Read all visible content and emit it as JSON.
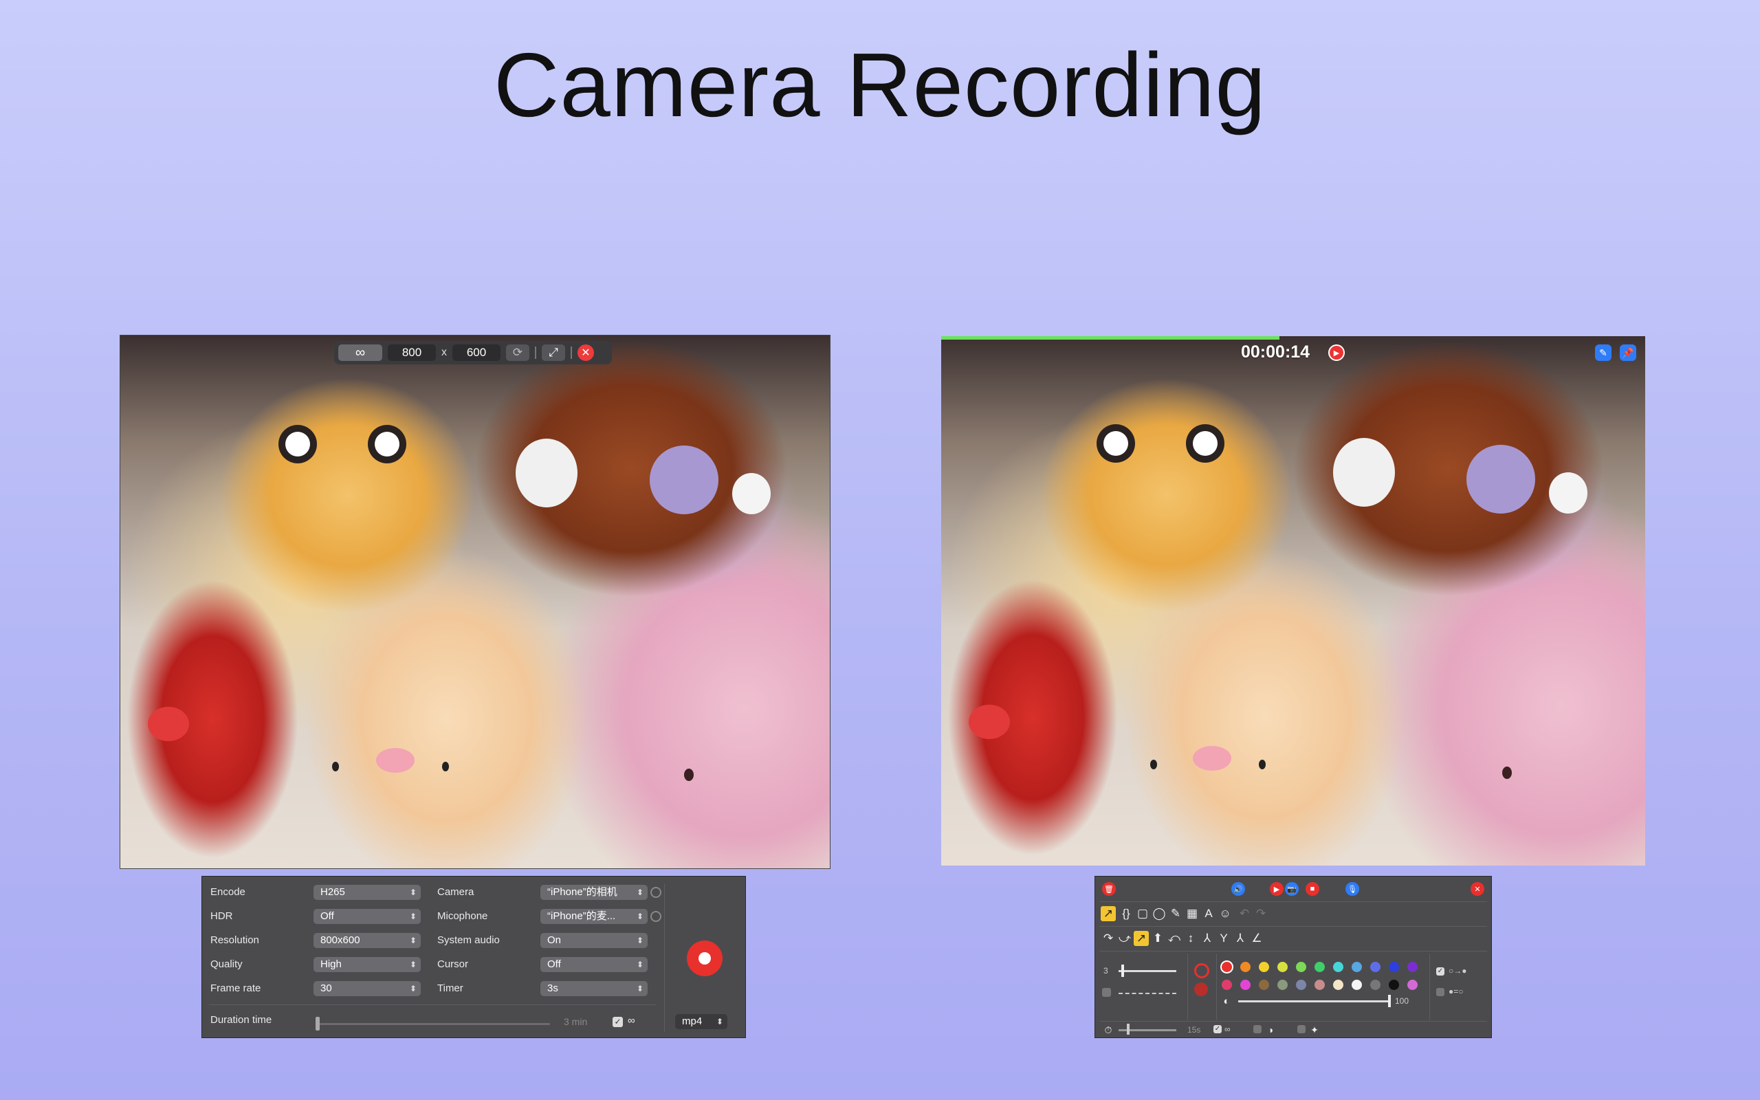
{
  "title": "Camera Recording",
  "left_toolbar": {
    "infinity": "∞",
    "width": "800",
    "x": "x",
    "height": "600",
    "close": "✕"
  },
  "recording": {
    "elapsed": "00:00:14",
    "progress": 0.48
  },
  "settings": {
    "encode_label": "Encode",
    "encode_value": "H265",
    "hdr_label": "HDR",
    "hdr_value": "Off",
    "resolution_label": "Resolution",
    "resolution_value": "800x600",
    "quality_label": "Quality",
    "quality_value": "High",
    "framerate_label": "Frame rate",
    "framerate_value": "30",
    "camera_label": "Camera",
    "camera_value": "“iPhone”的相机",
    "mic_label": "Micophone",
    "mic_value": "“iPhone”的麦...",
    "sysaudio_label": "System audio",
    "sysaudio_value": "On",
    "cursor_label": "Cursor",
    "cursor_value": "Off",
    "timer_label": "Timer",
    "timer_value": "3s",
    "duration_label": "Duration time",
    "duration_max": "3 min",
    "infinity": "∞",
    "format": "mp4"
  },
  "annotation": {
    "stroke_width": "3",
    "opacity": "100",
    "delay": "15s",
    "infinity": "∞",
    "colors_row1": [
      "#e8302c",
      "#f08a24",
      "#f3d12c",
      "#d7e040",
      "#7ed957",
      "#3fcf6a",
      "#47d6d8",
      "#58a7e3",
      "#5f6ee8",
      "#2c3fe0",
      "#7a2ed0"
    ],
    "colors_row2": [
      "#e23c6a",
      "#e444d6",
      "#8a6a3e",
      "#8a9a7c",
      "#7c86a8",
      "#c88c8c",
      "#f3e6c8",
      "#f5f5f5",
      "#777777",
      "#111111",
      "#d26bd6"
    ]
  }
}
